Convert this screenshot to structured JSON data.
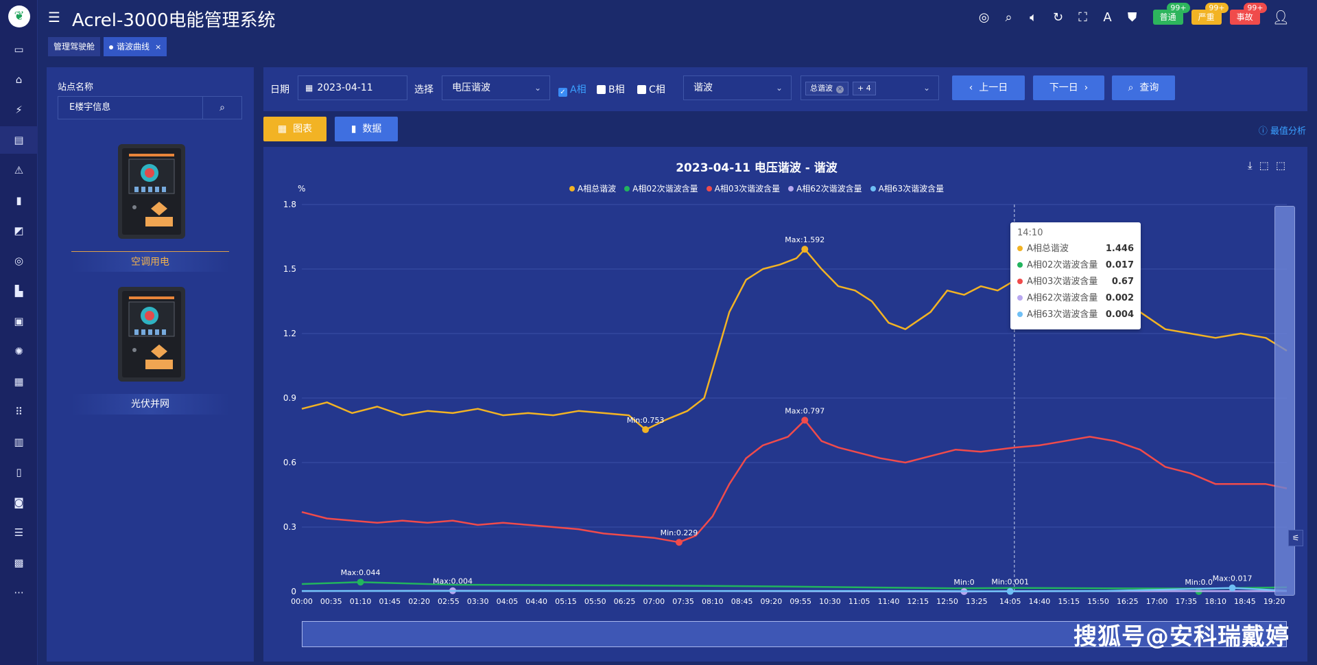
{
  "app": {
    "logo_icon": "leaf-logo-icon",
    "title": "Acrel-3000电能管理系统"
  },
  "rail": {
    "items": [
      {
        "name": "monitor-icon",
        "glyph": "▭"
      },
      {
        "name": "home-icon",
        "glyph": "⌂"
      },
      {
        "name": "power-icon",
        "glyph": "⚡"
      },
      {
        "name": "report-icon",
        "glyph": "▤"
      },
      {
        "name": "alarm-icon",
        "glyph": "⚠"
      },
      {
        "name": "bar-chart-icon",
        "glyph": "▮"
      },
      {
        "name": "area-chart-icon",
        "glyph": "◩"
      },
      {
        "name": "search-device-icon",
        "glyph": "◎"
      },
      {
        "name": "factory-icon",
        "glyph": "▙"
      },
      {
        "name": "screen-icon",
        "glyph": "▣"
      },
      {
        "name": "bulb-icon",
        "glyph": "✺"
      },
      {
        "name": "grid-icon",
        "glyph": "▦"
      },
      {
        "name": "apps-icon",
        "glyph": "⠿"
      },
      {
        "name": "server-icon",
        "glyph": "▥"
      },
      {
        "name": "battery-icon",
        "glyph": "▯"
      },
      {
        "name": "camera-icon",
        "glyph": "◙"
      },
      {
        "name": "table-icon",
        "glyph": "☰"
      },
      {
        "name": "cabinet-icon",
        "glyph": "▩"
      },
      {
        "name": "more-icon",
        "glyph": "···"
      }
    ]
  },
  "header": {
    "icons": [
      "help-ring-icon",
      "search-icon",
      "volume-icon",
      "refresh-icon",
      "fullscreen-icon",
      "translate-icon",
      "shirt-icon"
    ],
    "badges": [
      {
        "label": "普通",
        "count": "99+",
        "bg": "#2db55d",
        "count_bg": "#2db55d"
      },
      {
        "label": "严重",
        "count": "99+",
        "bg": "#f2b324",
        "count_bg": "#f2b324"
      },
      {
        "label": "事故",
        "count": "99+",
        "bg": "#f04b4b",
        "count_bg": "#f04b4b"
      }
    ]
  },
  "tabs": [
    {
      "label": "管理驾驶舱",
      "active": false
    },
    {
      "label": "谐波曲线",
      "active": true,
      "close": "×"
    }
  ],
  "site": {
    "title": "站点名称",
    "input_value": "E楼宇信息",
    "devices": [
      {
        "label": "空调用电",
        "selected": true
      },
      {
        "label": "光伏并网",
        "selected": false
      }
    ]
  },
  "toolbar": {
    "date_label": "日期",
    "date_value": "2023-04-11",
    "select_label": "选择",
    "select_value": "电压谐波",
    "phase_a": "A相",
    "phase_b": "B相",
    "phase_c": "C相",
    "type_value": "谐波",
    "tag_value": "总谐波",
    "tag_more": "+ 4",
    "prev_label": "上一日",
    "next_label": "下一日",
    "query_label": "查询"
  },
  "view": {
    "chart_label": "图表",
    "data_label": "数据",
    "peak_label": "最值分析"
  },
  "chart_data": {
    "type": "line",
    "title": "2023-04-11  电压谐波 - 谐波",
    "ylabel": "%",
    "ylim": [
      0,
      1.8
    ],
    "yticks": [
      0,
      0.3,
      0.6,
      0.9,
      1.2,
      1.5,
      1.8
    ],
    "xticks": [
      "00:00",
      "00:35",
      "01:10",
      "01:45",
      "02:20",
      "02:55",
      "03:30",
      "04:05",
      "04:40",
      "05:15",
      "05:50",
      "06:25",
      "07:00",
      "07:35",
      "08:10",
      "08:45",
      "09:20",
      "09:55",
      "10:30",
      "11:05",
      "11:40",
      "12:15",
      "12:50",
      "13:25",
      "14:05",
      "14:40",
      "15:15",
      "15:50",
      "16:25",
      "17:00",
      "17:35",
      "18:10",
      "18:45",
      "19:20"
    ],
    "legend_position": "top-center",
    "grid": true,
    "series": [
      {
        "name": "A相总谐波",
        "color": "#f2b324",
        "points": [
          [
            "00:00",
            0.85
          ],
          [
            "00:30",
            0.88
          ],
          [
            "01:00",
            0.83
          ],
          [
            "01:30",
            0.86
          ],
          [
            "02:00",
            0.82
          ],
          [
            "02:30",
            0.84
          ],
          [
            "03:00",
            0.83
          ],
          [
            "03:30",
            0.85
          ],
          [
            "04:00",
            0.82
          ],
          [
            "04:30",
            0.83
          ],
          [
            "05:00",
            0.82
          ],
          [
            "05:30",
            0.84
          ],
          [
            "06:00",
            0.83
          ],
          [
            "06:30",
            0.82
          ],
          [
            "06:50",
            0.753
          ],
          [
            "07:15",
            0.8
          ],
          [
            "07:40",
            0.84
          ],
          [
            "08:00",
            0.9
          ],
          [
            "08:15",
            1.1
          ],
          [
            "08:30",
            1.3
          ],
          [
            "08:50",
            1.45
          ],
          [
            "09:10",
            1.5
          ],
          [
            "09:30",
            1.52
          ],
          [
            "09:50",
            1.55
          ],
          [
            "10:00",
            1.592
          ],
          [
            "10:20",
            1.5
          ],
          [
            "10:40",
            1.42
          ],
          [
            "11:00",
            1.4
          ],
          [
            "11:20",
            1.35
          ],
          [
            "11:40",
            1.25
          ],
          [
            "12:00",
            1.22
          ],
          [
            "12:30",
            1.3
          ],
          [
            "12:50",
            1.4
          ],
          [
            "13:10",
            1.38
          ],
          [
            "13:30",
            1.42
          ],
          [
            "13:50",
            1.4
          ],
          [
            "14:10",
            1.446
          ],
          [
            "14:30",
            1.42
          ],
          [
            "14:50",
            1.38
          ],
          [
            "15:10",
            1.33
          ],
          [
            "15:40",
            1.32
          ],
          [
            "16:10",
            1.36
          ],
          [
            "16:40",
            1.3
          ],
          [
            "17:10",
            1.22
          ],
          [
            "17:40",
            1.2
          ],
          [
            "18:10",
            1.18
          ],
          [
            "18:40",
            1.2
          ],
          [
            "19:10",
            1.18
          ],
          [
            "19:35",
            1.12
          ]
        ],
        "markers": [
          {
            "x": "10:00",
            "y": 1.592,
            "label": "Max:1.592"
          },
          {
            "x": "06:50",
            "y": 0.753,
            "label": "Min:0.753"
          }
        ]
      },
      {
        "name": "A相02次谐波含量",
        "color": "#22b45e",
        "points": [
          [
            "00:00",
            0.035
          ],
          [
            "01:10",
            0.044
          ],
          [
            "03:00",
            0.032
          ],
          [
            "05:00",
            0.03
          ],
          [
            "07:00",
            0.028
          ],
          [
            "09:00",
            0.025
          ],
          [
            "11:00",
            0.02
          ],
          [
            "13:00",
            0.015
          ],
          [
            "14:10",
            0.017
          ],
          [
            "16:00",
            0.015
          ],
          [
            "18:00",
            0.014
          ],
          [
            "19:35",
            0.02
          ]
        ],
        "markers": [
          {
            "x": "01:10",
            "y": 0.044,
            "label": "Max:0.044"
          },
          {
            "x": "17:50",
            "y": 0,
            "label": "Min:0.0"
          }
        ]
      },
      {
        "name": "A相03次谐波含量",
        "color": "#f04b4b",
        "points": [
          [
            "00:00",
            0.37
          ],
          [
            "00:30",
            0.34
          ],
          [
            "01:00",
            0.33
          ],
          [
            "01:30",
            0.32
          ],
          [
            "02:00",
            0.33
          ],
          [
            "02:30",
            0.32
          ],
          [
            "03:00",
            0.33
          ],
          [
            "03:30",
            0.31
          ],
          [
            "04:00",
            0.32
          ],
          [
            "04:30",
            0.31
          ],
          [
            "05:00",
            0.3
          ],
          [
            "05:30",
            0.29
          ],
          [
            "06:00",
            0.27
          ],
          [
            "06:30",
            0.26
          ],
          [
            "07:00",
            0.25
          ],
          [
            "07:30",
            0.229
          ],
          [
            "07:50",
            0.26
          ],
          [
            "08:10",
            0.35
          ],
          [
            "08:30",
            0.5
          ],
          [
            "08:50",
            0.62
          ],
          [
            "09:10",
            0.68
          ],
          [
            "09:40",
            0.72
          ],
          [
            "10:00",
            0.797
          ],
          [
            "10:20",
            0.7
          ],
          [
            "10:40",
            0.67
          ],
          [
            "11:00",
            0.65
          ],
          [
            "11:30",
            0.62
          ],
          [
            "12:00",
            0.6
          ],
          [
            "12:30",
            0.63
          ],
          [
            "13:00",
            0.66
          ],
          [
            "13:30",
            0.65
          ],
          [
            "14:10",
            0.67
          ],
          [
            "14:40",
            0.68
          ],
          [
            "15:10",
            0.7
          ],
          [
            "15:40",
            0.72
          ],
          [
            "16:10",
            0.7
          ],
          [
            "16:40",
            0.66
          ],
          [
            "17:10",
            0.58
          ],
          [
            "17:40",
            0.55
          ],
          [
            "18:10",
            0.5
          ],
          [
            "18:40",
            0.5
          ],
          [
            "19:10",
            0.5
          ],
          [
            "19:35",
            0.48
          ]
        ],
        "markers": [
          {
            "x": "10:00",
            "y": 0.797,
            "label": "Max:0.797"
          },
          {
            "x": "07:30",
            "y": 0.229,
            "label": "Min:0.229"
          }
        ]
      },
      {
        "name": "A相62次谐波含量",
        "color": "#b9a8f0",
        "points": [
          [
            "00:00",
            0.002
          ],
          [
            "03:00",
            0.004
          ],
          [
            "06:00",
            0.003
          ],
          [
            "09:00",
            0.002
          ],
          [
            "13:10",
            0
          ],
          [
            "14:10",
            0.002
          ],
          [
            "17:00",
            0.002
          ],
          [
            "19:35",
            0.002
          ]
        ],
        "markers": [
          {
            "x": "03:00",
            "y": 0.004,
            "label": "Max:0.004"
          },
          {
            "x": "13:10",
            "y": 0,
            "label": "Min:0"
          }
        ]
      },
      {
        "name": "A相63次谐波含量",
        "color": "#6fbff5",
        "points": [
          [
            "00:00",
            0.003
          ],
          [
            "06:00",
            0.003
          ],
          [
            "12:00",
            0.003
          ],
          [
            "14:05",
            0.001
          ],
          [
            "16:00",
            0.003
          ],
          [
            "18:30",
            0.017
          ],
          [
            "19:35",
            0.004
          ]
        ],
        "markers": [
          {
            "x": "14:05",
            "y": 0.001,
            "label": "Min:0.001"
          },
          {
            "x": "18:30",
            "y": 0.017,
            "label": "Max:0.017"
          }
        ]
      }
    ],
    "tooltip": {
      "time": "14:10",
      "rows": [
        {
          "name": "A相总谐波",
          "value": "1.446",
          "color": "#f2b324"
        },
        {
          "name": "A相02次谐波含量",
          "value": "0.017",
          "color": "#22b45e"
        },
        {
          "name": "A相03次谐波含量",
          "value": "0.67",
          "color": "#f04b4b"
        },
        {
          "name": "A相62次谐波含量",
          "value": "0.002",
          "color": "#b9a8f0"
        },
        {
          "name": "A相63次谐波含量",
          "value": "0.004",
          "color": "#6fbff5"
        }
      ]
    }
  },
  "watermark": "搜狐号@安科瑞戴婷"
}
